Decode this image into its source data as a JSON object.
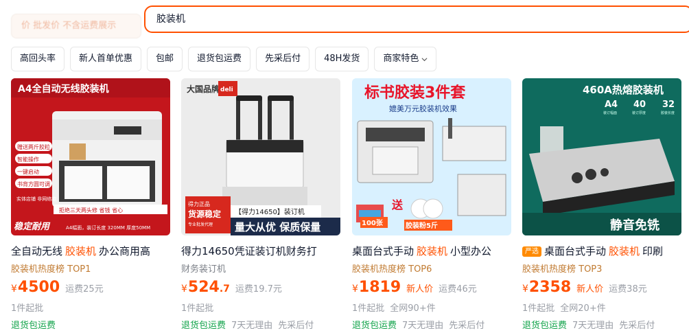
{
  "top_filter": "价 批发价 不含运费展示",
  "search": {
    "value": "胶装机"
  },
  "chips": [
    {
      "label": "高回头率"
    },
    {
      "label": "新人首单优惠"
    },
    {
      "label": "包邮"
    },
    {
      "label": "退货包运费"
    },
    {
      "label": "先采后付"
    },
    {
      "label": "48H发货"
    },
    {
      "label": "商家特色",
      "has_dropdown": true
    }
  ],
  "products": [
    {
      "image_banner": "A4全自动无线胶装机",
      "image_texts": [
        "赠送两斤胶粒",
        "智能操作",
        "一键启动",
        "书背方圆可调",
        "实体店铺 非网络款",
        "拒绝三天两头修 省钱 省心",
        "稳定耐用",
        "A4幅面，装订长度 320MM 厚度50MM"
      ],
      "title_before": "全自动无线",
      "title_highlight": "胶装机",
      "title_after": "办公商用高",
      "tag": "",
      "rank": "胶装机热度榜 TOP1",
      "price_int": "4500",
      "price_dec": "",
      "new_price": "",
      "shipping": "运费25元",
      "meta": [
        "1件起批"
      ],
      "services": [
        "退货包运费"
      ]
    },
    {
      "image_banner": "",
      "image_texts": [
        "大国品牌",
        "deli",
        "得力正品",
        "货源稳定",
        "专业批发代理",
        "【得力14650】装订机",
        "量大从优 保质保量"
      ],
      "title_before": "得力14650凭证装订机财务打",
      "title_highlight": "",
      "title_after": "",
      "tag": "",
      "rank": "财务装订机",
      "price_int": "524",
      "price_dec": ".7",
      "new_price": "",
      "shipping": "运费19.7元",
      "meta": [
        "1件起批"
      ],
      "services": [
        "退货包运费",
        "7天无理由",
        "先采后付"
      ]
    },
    {
      "image_banner": "标书胶装3件套",
      "image_texts": [
        "媲美万元胶装机效果",
        "送",
        "100张",
        "胶装粉5斤"
      ],
      "title_before": "桌面台式手动",
      "title_highlight": "胶装机",
      "title_after": "小型办公",
      "tag": "",
      "rank": "胶装机热度榜 TOP6",
      "price_int": "1819",
      "price_dec": "",
      "new_price": "新人价",
      "shipping": "运费46元",
      "meta": [
        "1件起批",
        "全网90+件"
      ],
      "services": [
        "退货包运费",
        "7天无理由",
        "先采后付"
      ]
    },
    {
      "image_banner": "460A热熔胶装机",
      "image_texts": [
        "A4",
        "40",
        "32",
        "装订幅面",
        "装订厚度",
        "胶装长度",
        "静音免铣"
      ],
      "title_before": "桌面台式手动",
      "title_highlight": "胶装机",
      "title_after": "印刷",
      "tag": "严选",
      "rank": "胶装机热度榜 TOP3",
      "price_int": "2358",
      "price_dec": "",
      "new_price": "新人价",
      "shipping": "运费38元",
      "meta": [
        "1件起批",
        "全网20+件"
      ],
      "services": [
        "退货包运费",
        "7天无理由",
        "先采后付"
      ]
    }
  ],
  "colors": {
    "accent": "#ff5000",
    "green": "#11a34a",
    "rank": "#c17b32"
  }
}
